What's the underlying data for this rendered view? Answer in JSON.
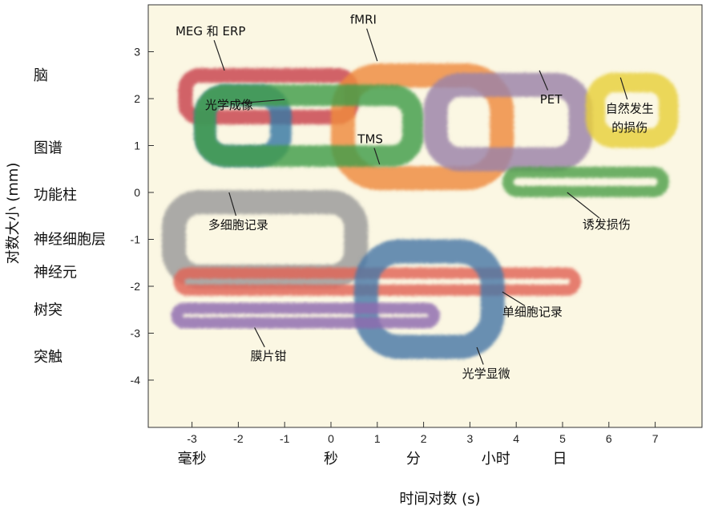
{
  "chart_data": {
    "type": "area",
    "title": "",
    "xlabel": "时间对数 (s)",
    "ylabel": "对数大小 (mm)",
    "xlim": [
      -4.0,
      7.6
    ],
    "ylim": [
      -5.0,
      4.0
    ],
    "x_ticks": [
      -3,
      -2,
      -1,
      0,
      1,
      2,
      3,
      4,
      5,
      6,
      7
    ],
    "y_ticks": [
      3,
      2,
      1,
      0,
      -1,
      -2,
      -3,
      -4
    ],
    "grid": false,
    "legend": "none",
    "y_levels": [
      {
        "label": "脑",
        "y": 2.5
      },
      {
        "label": "图谱",
        "y": 0.95
      },
      {
        "label": "功能柱",
        "y": -0.05
      },
      {
        "label": "神经细胞层",
        "y": -1.0
      },
      {
        "label": "神经元",
        "y": -1.7
      },
      {
        "label": "树突",
        "y": -2.5
      },
      {
        "label": "突触",
        "y": -3.5
      }
    ],
    "x_units": [
      {
        "label": "毫秒",
        "x": -3.0
      },
      {
        "label": "秒",
        "x": 0.0
      },
      {
        "label": "分",
        "x": 1.78
      },
      {
        "label": "小时",
        "x": 3.56
      },
      {
        "label": "日",
        "x": 4.94
      }
    ],
    "regions": [
      {
        "name": "MEG 和 ERP",
        "x": [
          -3.3,
          0.6
        ],
        "y": [
          1.45,
          2.65
        ],
        "color": "#c8424d"
      },
      {
        "name": "光学成像",
        "x": [
          -2.95,
          -0.85
        ],
        "y": [
          0.55,
          2.3
        ],
        "color": "#3677a3"
      },
      {
        "name": "fMRI",
        "x": [
          0.0,
          3.95
        ],
        "y": [
          0.05,
          2.75
        ],
        "color": "#ee8a3e"
      },
      {
        "name": "TMS",
        "x": [
          -2.95,
          2.0
        ],
        "y": [
          0.55,
          2.3
        ],
        "color": "#3f9c4a"
      },
      {
        "name": "PET",
        "x": [
          2.0,
          5.65
        ],
        "y": [
          0.45,
          2.55
        ],
        "color": "#9b82a8"
      },
      {
        "name": "自然发生的损伤",
        "x": [
          5.5,
          7.5
        ],
        "y": [
          0.95,
          2.55
        ],
        "color": "#e8cf39"
      },
      {
        "name": "诱发损伤",
        "x": [
          3.7,
          7.3
        ],
        "y": [
          -0.1,
          0.55
        ],
        "color": "#4fa04a"
      },
      {
        "name": "多细胞记录",
        "x": [
          -3.65,
          0.8
        ],
        "y": [
          -2.05,
          0.05
        ],
        "color": "#9a9a9a"
      },
      {
        "name": "单细胞记录",
        "x": [
          -3.4,
          5.4
        ],
        "y": [
          -2.2,
          -1.6
        ],
        "color": "#e16355"
      },
      {
        "name": "光学显微",
        "x": [
          0.5,
          3.75
        ],
        "y": [
          -3.55,
          -1.0
        ],
        "color": "#4b77a6"
      },
      {
        "name": "膜片钳",
        "x": [
          -3.45,
          2.35
        ],
        "y": [
          -2.9,
          -2.35
        ],
        "color": "#8e6aae"
      }
    ],
    "annotations": [
      {
        "text": "MEG 和 ERP",
        "at": [
          -2.6,
          3.35
        ],
        "to": [
          -2.3,
          2.6
        ]
      },
      {
        "text": "fMRI",
        "at": [
          0.7,
          3.6
        ],
        "to": [
          1.0,
          2.8
        ]
      },
      {
        "text": "光学成像",
        "at": [
          -2.2,
          1.78
        ],
        "to": [
          -1.0,
          1.98
        ]
      },
      {
        "text": "TMS",
        "at": [
          0.85,
          1.05
        ],
        "to": [
          1.05,
          0.6
        ]
      },
      {
        "text": "PET",
        "at": [
          4.75,
          1.9
        ],
        "to": [
          4.5,
          2.6
        ]
      },
      {
        "text": "自然发生",
        "at": [
          6.45,
          1.7
        ],
        "to": [
          6.25,
          2.45
        ]
      },
      {
        "text": "的损伤",
        "at": [
          6.45,
          1.3
        ],
        "to": null
      },
      {
        "text": "多细胞记录",
        "at": [
          -2.0,
          -0.78
        ],
        "to": [
          -2.2,
          0.0
        ]
      },
      {
        "text": "诱发损伤",
        "at": [
          5.95,
          -0.77
        ],
        "to": [
          5.1,
          0.0
        ]
      },
      {
        "text": "单细胞记录",
        "at": [
          4.35,
          -2.63
        ],
        "to": [
          3.7,
          -2.12
        ]
      },
      {
        "text": "膜片钳",
        "at": [
          -1.35,
          -3.57
        ],
        "to": [
          -1.65,
          -2.88
        ]
      },
      {
        "text": "光学显微",
        "at": [
          3.35,
          -3.95
        ],
        "to": [
          3.15,
          -3.3
        ]
      }
    ]
  }
}
